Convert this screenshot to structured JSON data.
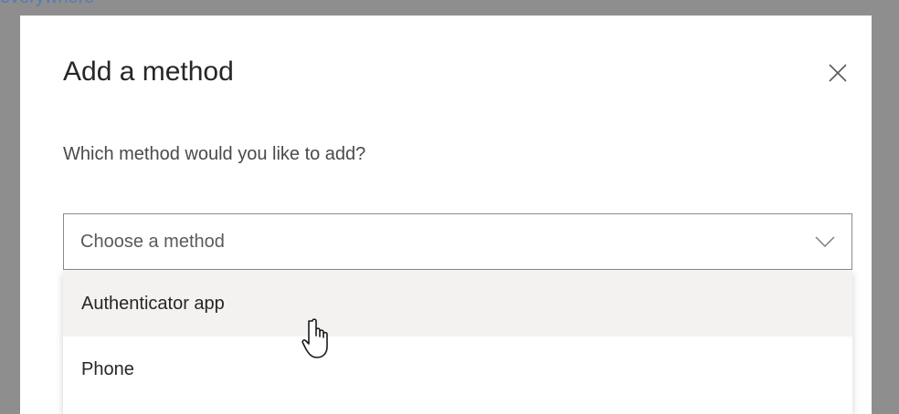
{
  "background": {
    "link_text": "everywhere"
  },
  "modal": {
    "title": "Add a method",
    "close_icon": "close-icon",
    "prompt": "Which method would you like to add?",
    "select": {
      "placeholder": "Choose a method",
      "chevron_icon": "chevron-down-icon",
      "options": [
        {
          "label": "Authenticator app",
          "hovered": true
        },
        {
          "label": "Phone",
          "hovered": false
        }
      ]
    }
  },
  "cursor": {
    "icon": "hand-pointer-icon"
  },
  "colors": {
    "backdrop": "#8e8e8e",
    "modal_background": "#ffffff",
    "hover_background": "#f3f2f1",
    "text_primary": "#262626",
    "link": "#4f7bb8"
  }
}
